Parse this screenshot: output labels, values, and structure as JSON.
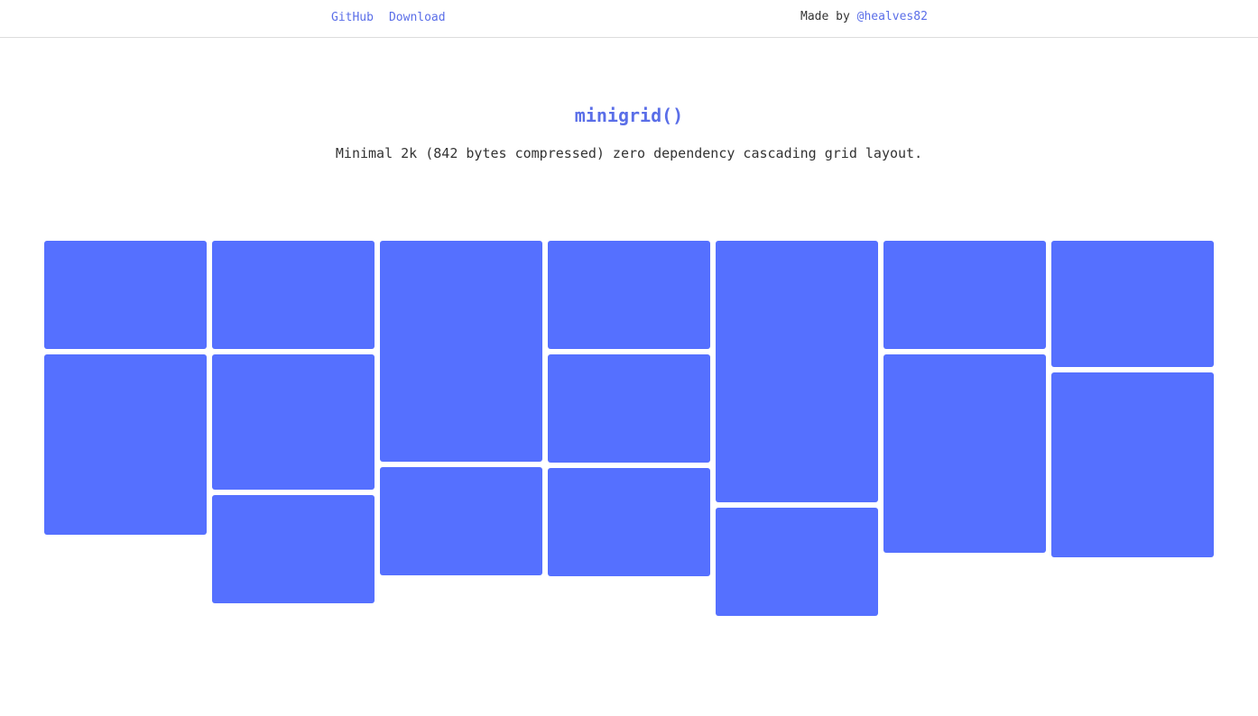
{
  "nav": {
    "github_label": "GitHub",
    "download_label": "Download"
  },
  "credit": {
    "prefix": "Made by",
    "handle": "@healves82"
  },
  "hero": {
    "title": "minigrid()",
    "subtitle": "Minimal 2k (842 bytes compressed) zero dependency cascading grid layout."
  },
  "colors": {
    "accent": "#5a6ee8",
    "tile": "#5570ff"
  },
  "grid": {
    "columns": 7,
    "tile_heights": [
      [
        120,
        200
      ],
      [
        120,
        150,
        120
      ],
      [
        245,
        120
      ],
      [
        120,
        120,
        120
      ],
      [
        290,
        120
      ],
      [
        120,
        220
      ],
      [
        140,
        205
      ]
    ]
  }
}
